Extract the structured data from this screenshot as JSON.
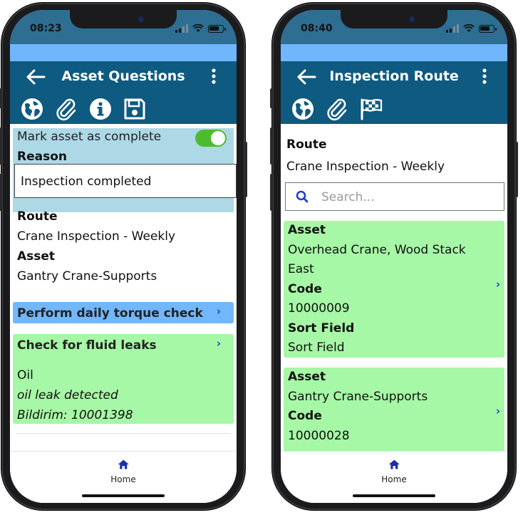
{
  "colors": {
    "toolbar": "#0f5a80",
    "status_bar": "#2e6e93",
    "light_band": "#6fb6fd",
    "complete_panel": "#add8e6",
    "question_selected": "#72b7fa",
    "card_green": "#a6f7a6",
    "toggle_on": "#4cbb2c",
    "chevron": "#1a3fd0",
    "home_icon": "#1a2faa"
  },
  "left": {
    "status": {
      "time": "08:23"
    },
    "header": {
      "title": "Asset Questions",
      "icons": [
        "globe-icon",
        "paperclip-icon",
        "info-icon",
        "save-icon"
      ]
    },
    "complete": {
      "label": "Mark asset as complete",
      "toggle_on": true,
      "reason_label": "Reason",
      "reason_value": "Inspection completed"
    },
    "info": {
      "route_label": "Route",
      "route_value": "Crane Inspection - Weekly",
      "asset_label": "Asset",
      "asset_value": "Gantry Crane-Supports"
    },
    "questions": [
      {
        "title": "Perform daily torque check"
      },
      {
        "title": "Check for fluid leaks",
        "answer": "Oil",
        "note": "oil leak detected",
        "notification": "Bildirim: 10001398"
      }
    ],
    "tabbar": {
      "home_label": "Home"
    }
  },
  "right": {
    "status": {
      "time": "08:40"
    },
    "header": {
      "title": "Inspection Route",
      "icons": [
        "globe-icon",
        "paperclip-icon",
        "flag-icon"
      ]
    },
    "route": {
      "label": "Route",
      "value": "Crane Inspection - Weekly"
    },
    "search": {
      "placeholder": "Search..."
    },
    "assets": [
      {
        "asset_label": "Asset",
        "asset_value": "Overhead Crane, Wood Stack East",
        "code_label": "Code",
        "code_value": "10000009",
        "sort_label": "Sort Field",
        "sort_value": "Sort Field"
      },
      {
        "asset_label": "Asset",
        "asset_value": "Gantry Crane-Supports",
        "code_label": "Code",
        "code_value": "10000028"
      }
    ],
    "tabbar": {
      "home_label": "Home"
    }
  }
}
